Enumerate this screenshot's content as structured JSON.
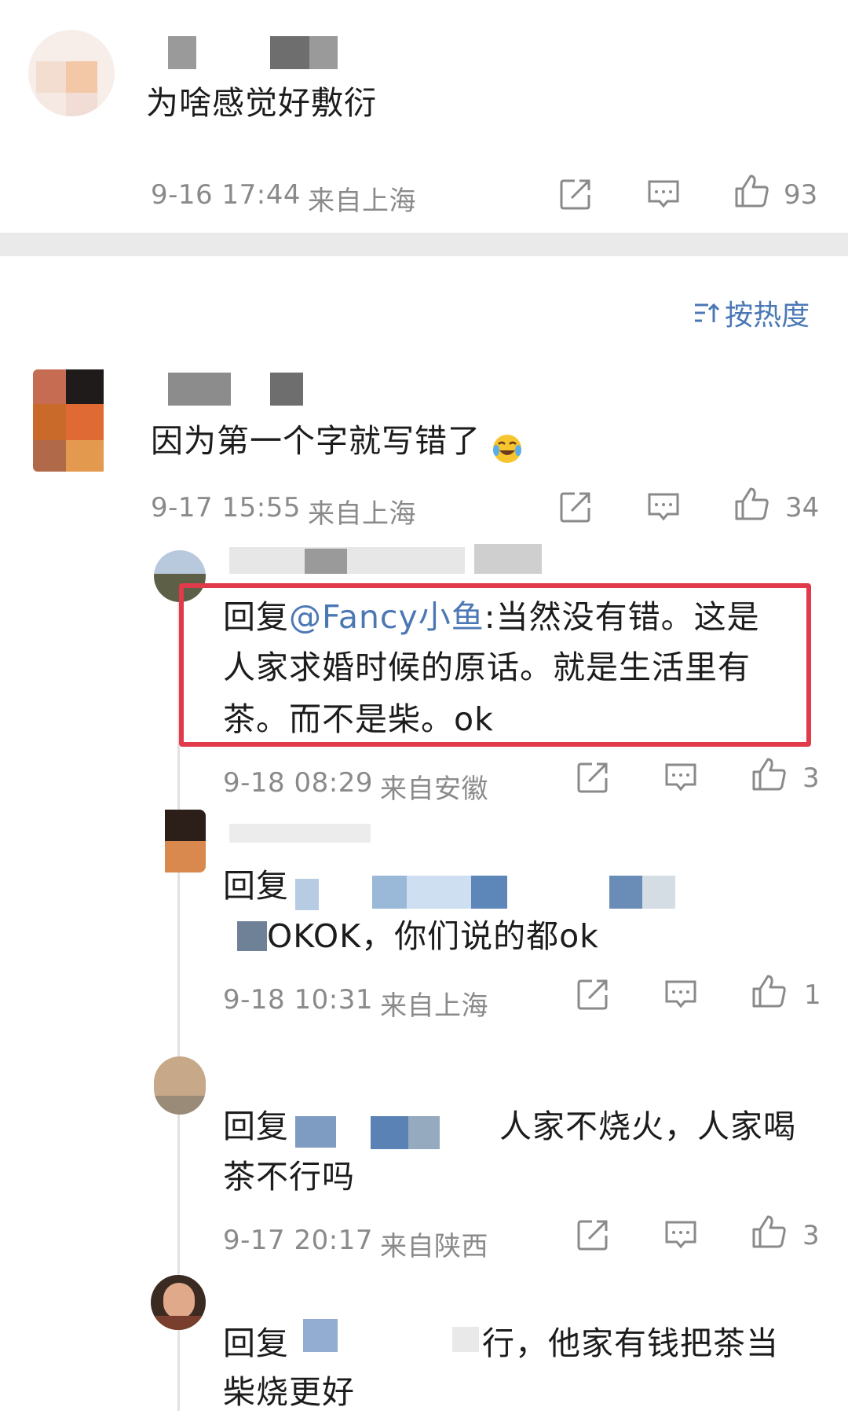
{
  "top_comment": {
    "text": "为啥感觉好敷衍",
    "time": "9-16 17:44",
    "location": "来自上海",
    "likes": "93"
  },
  "sort_label": "按热度",
  "main_comment": {
    "text": "因为第一个字就写错了",
    "time": "9-17 15:55",
    "location": "来自上海",
    "likes": "34",
    "emoji": "laugh-cry-emoji"
  },
  "replies": [
    {
      "prefix": "回复",
      "mention": "@Fancy小鱼",
      "text_line1": ":当然没有错。这是",
      "text_line2": "人家求婚时候的原话。就是生活里有",
      "text_line3": "茶。而不是柴。ok",
      "time": "9-18 08:29",
      "location": "来自安徽",
      "likes": "3"
    },
    {
      "prefix": "回复",
      "text_line2": "OKOK，你们说的都ok",
      "time": "9-18 10:31",
      "location": "来自上海",
      "likes": "1"
    },
    {
      "prefix": "回复",
      "text_line1": "人家不烧火，人家喝",
      "text_line2": "茶不行吗",
      "time": "9-17 20:17",
      "location": "来自陕西",
      "likes": "3"
    },
    {
      "prefix": "回复",
      "text_line1": "行，他家有钱把茶当",
      "text_line2": "柴烧更好"
    }
  ],
  "colors": {
    "accent": "#4b78b5",
    "highlight": "#e13a4b",
    "meta": "#8a8a8a"
  }
}
